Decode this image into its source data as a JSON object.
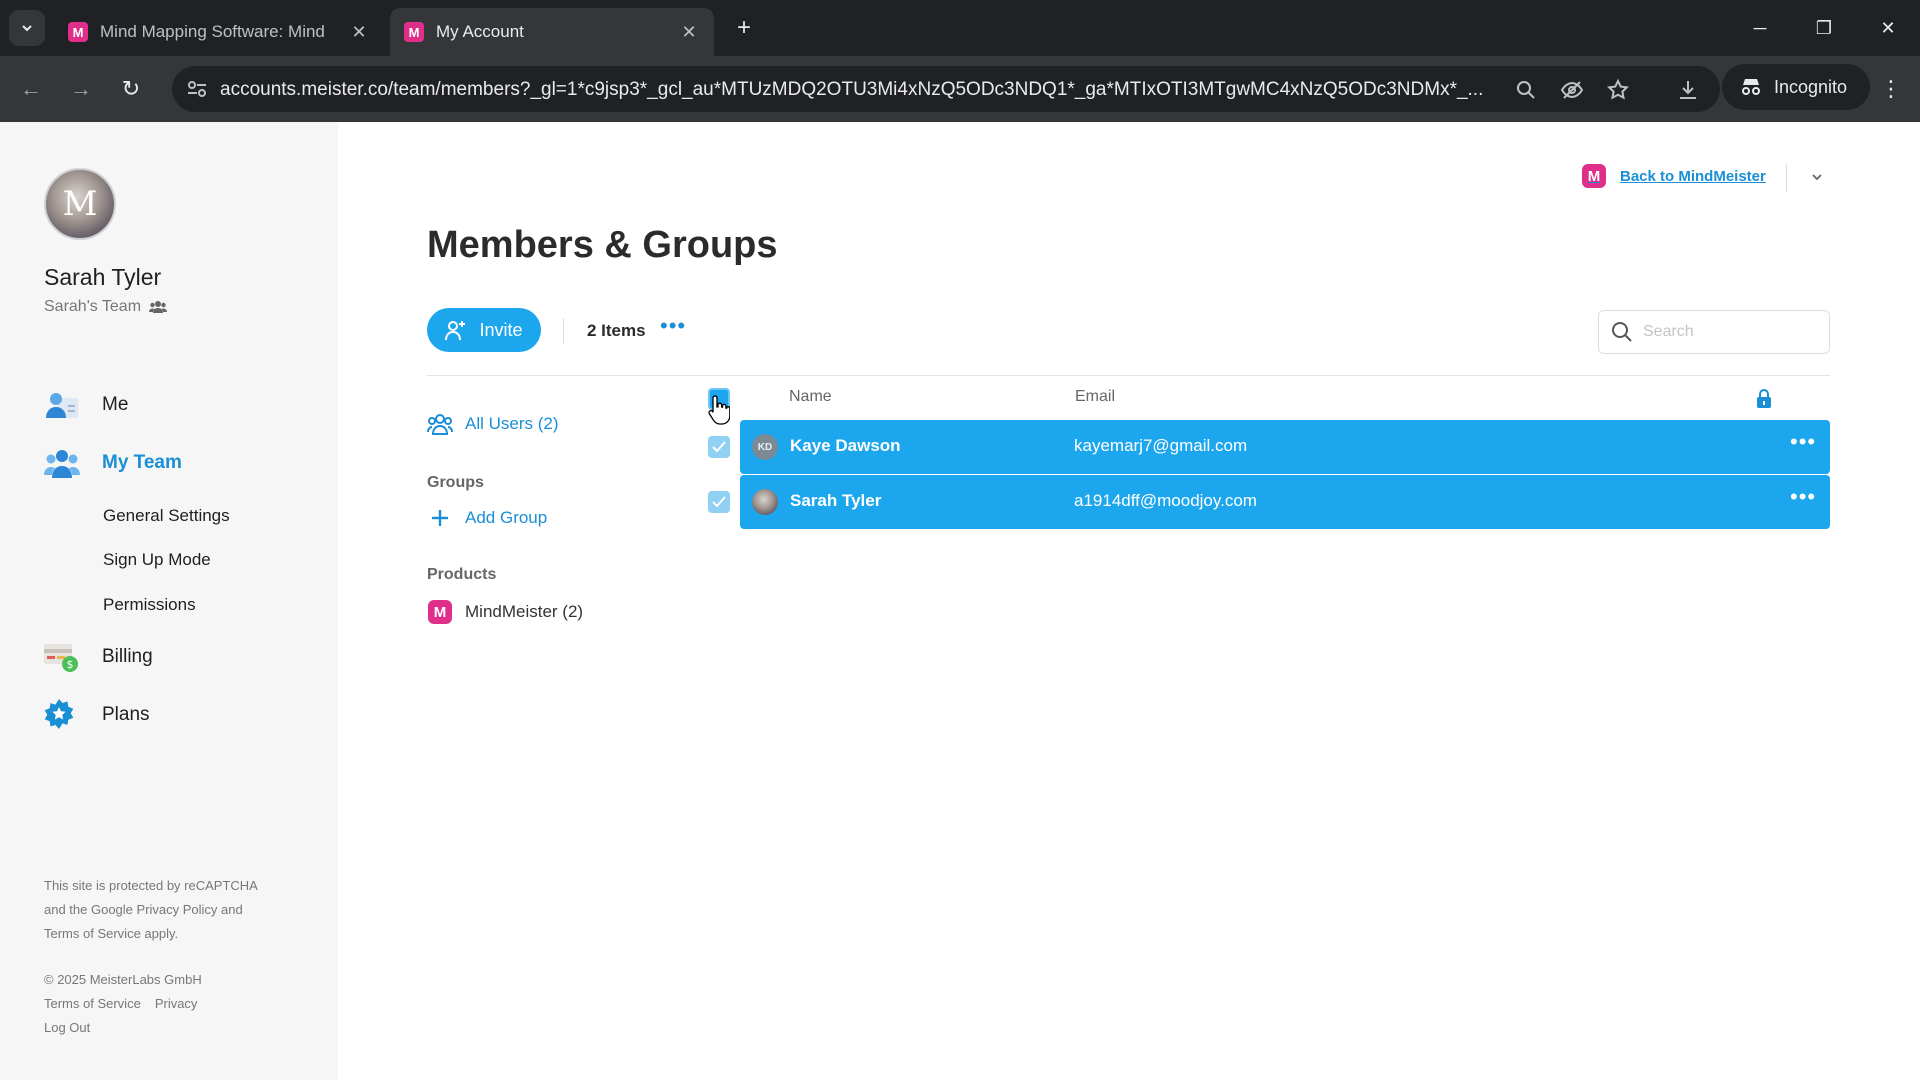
{
  "browser": {
    "tabs": [
      {
        "title": "Mind Mapping Software: Mind",
        "active": false
      },
      {
        "title": "My Account",
        "active": true
      }
    ],
    "favicon_letter": "M",
    "url": "accounts.meister.co/team/members?_gl=1*c9jsp3*_gcl_au*MTUzMDQ2OTU3Mi4xNzQ5ODc3NDQ1*_ga*MTIxOTI3MTgwMC4xNzQ5ODc3NDMx*_...",
    "incognito_label": "Incognito"
  },
  "sidebar": {
    "avatar_letter": "M",
    "user_name": "Sarah Tyler",
    "team_name": "Sarah's Team",
    "nav": [
      {
        "label": "Me",
        "icon": "person-icon"
      },
      {
        "label": "My Team",
        "icon": "team-icon",
        "active": true
      },
      {
        "label": "Billing",
        "icon": "billing-icon"
      },
      {
        "label": "Plans",
        "icon": "plans-icon"
      }
    ],
    "sub_nav": [
      "General Settings",
      "Sign Up Mode",
      "Permissions"
    ],
    "legal": {
      "recaptcha_line1": "This site is protected by reCAPTCHA",
      "recaptcha_line2": "and the Google Privacy Policy and",
      "recaptcha_line3": "Terms of Service apply.",
      "copyright": "© 2025 MeisterLabs GmbH",
      "terms": "Terms of Service",
      "privacy": "Privacy",
      "logout": "Log Out"
    }
  },
  "main": {
    "back_link": "Back to MindMeister",
    "title": "Members & Groups",
    "invite_label": "Invite",
    "items_count": "2 Items",
    "search_placeholder": "Search",
    "filters": {
      "all_users": "All Users (2)",
      "groups_label": "Groups",
      "add_group": "Add Group",
      "products_label": "Products",
      "mindmeister": "MindMeister (2)"
    },
    "table": {
      "col_name": "Name",
      "col_email": "Email",
      "rows": [
        {
          "initials": "KD",
          "name": "Kaye Dawson",
          "email": "kayemarj7@gmail.com",
          "selected": true
        },
        {
          "initials": "",
          "name": "Sarah Tyler",
          "email": "a1914dff@moodjoy.com",
          "selected": true
        }
      ]
    }
  },
  "colors": {
    "accent": "#1ca6ee",
    "link": "#1a8fd6",
    "brand": "#e02e8b"
  }
}
